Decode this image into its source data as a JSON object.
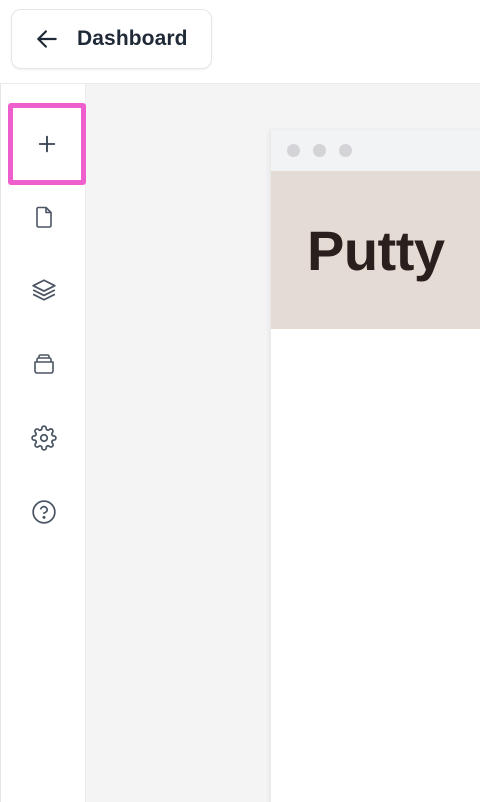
{
  "topbar": {
    "back_button_label": "Dashboard",
    "back_icon": "arrow-left-icon"
  },
  "rail": {
    "items": [
      {
        "id": "add",
        "icon": "plus-icon",
        "active": true
      },
      {
        "id": "pages",
        "icon": "file-icon",
        "active": false
      },
      {
        "id": "layers",
        "icon": "layers-icon",
        "active": false
      },
      {
        "id": "assets",
        "icon": "archive-icon",
        "active": false
      },
      {
        "id": "settings",
        "icon": "gear-icon",
        "active": false
      },
      {
        "id": "help",
        "icon": "help-circle-icon",
        "active": false
      }
    ],
    "active_highlight_color": "#ee5fcd"
  },
  "preview": {
    "window_dots": [
      "red",
      "yellow",
      "green"
    ],
    "hero_title": "Putty",
    "hero_background": "#e3dbd4",
    "hero_text_color": "#2a1f1d"
  }
}
